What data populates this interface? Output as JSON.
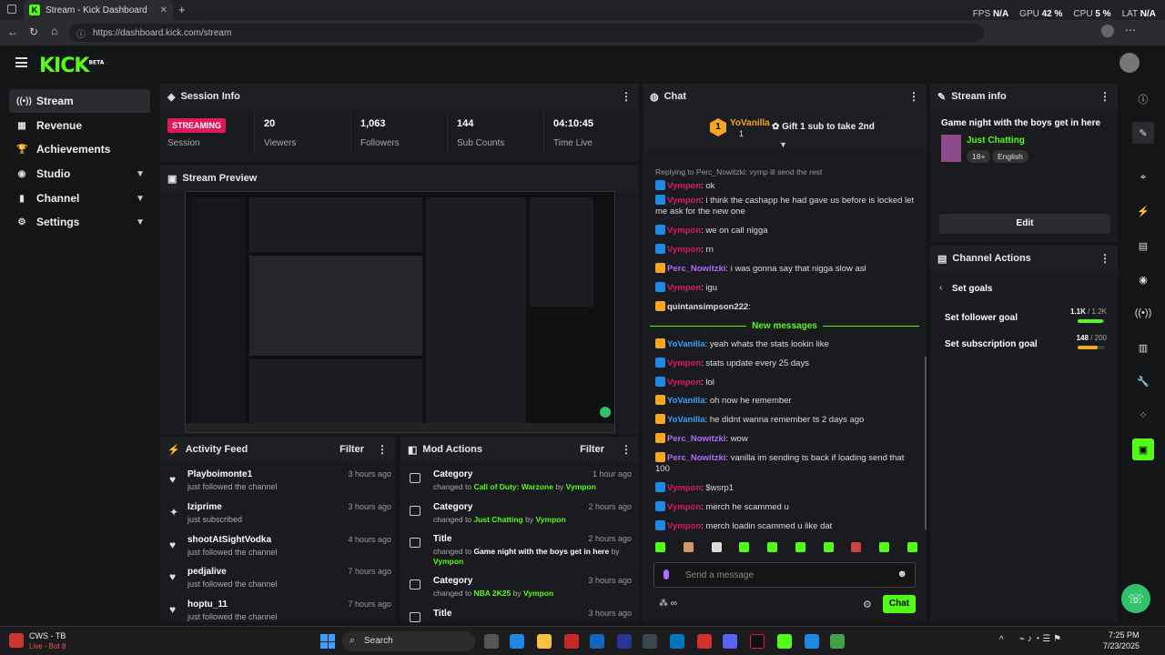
{
  "browser": {
    "tab_title": "Stream - Kick Dashboard",
    "url": "https://dashboard.kick.com/stream",
    "fps_label": "FPS",
    "fps": "N/A",
    "gpu_label": "GPU",
    "gpu": "42 %",
    "cpu_label": "CPU",
    "cpu": "5 %",
    "lat_label": "LAT",
    "lat": "N/A"
  },
  "app": {
    "logo": "KICK",
    "logo_tag": "BETA"
  },
  "sidebar": {
    "items": [
      {
        "label": "Stream",
        "icon": "broadcast-icon"
      },
      {
        "label": "Revenue",
        "icon": "revenue-icon"
      },
      {
        "label": "Achievements",
        "icon": "trophy-icon"
      },
      {
        "label": "Studio",
        "icon": "studio-icon"
      },
      {
        "label": "Channel",
        "icon": "channel-icon"
      },
      {
        "label": "Settings",
        "icon": "gear-icon"
      }
    ]
  },
  "session": {
    "title": "Session Info",
    "status": "STREAMING",
    "status_sub": "Session",
    "stats": [
      {
        "value": "20",
        "label": "Viewers"
      },
      {
        "value": "1,063",
        "label": "Followers"
      },
      {
        "value": "144",
        "label": "Sub Counts"
      },
      {
        "value": "04:10:45",
        "label": "Time Live"
      }
    ]
  },
  "preview": {
    "title": "Stream Preview"
  },
  "activity": {
    "title": "Activity Feed",
    "filter": "Filter",
    "items": [
      {
        "name": "Playboimonte1",
        "sub": "just followed the channel",
        "time": "3 hours ago",
        "icon": "heart-icon"
      },
      {
        "name": "Iziprime",
        "sub": "just subscribed",
        "time": "3 hours ago",
        "icon": "star-icon"
      },
      {
        "name": "shootAtSightVodka",
        "sub": "just followed the channel",
        "time": "4 hours ago",
        "icon": "heart-icon"
      },
      {
        "name": "pedjalive",
        "sub": "just followed the channel",
        "time": "7 hours ago",
        "icon": "heart-icon"
      },
      {
        "name": "hoptu_11",
        "sub": "just followed the channel",
        "time": "7 hours ago",
        "icon": "heart-icon"
      }
    ]
  },
  "mod": {
    "title": "Mod Actions",
    "filter": "Filter",
    "items": [
      {
        "name": "Category",
        "pre": "changed to ",
        "val": "Call of Duty: Warzone",
        "by": " by ",
        "user": "Vympon",
        "time": "1 hour ago"
      },
      {
        "name": "Category",
        "pre": "changed to ",
        "val": "Just Chatting",
        "by": " by ",
        "user": "Vympon",
        "time": "2 hours ago"
      },
      {
        "name": "Title",
        "pre": "changed to ",
        "val": "Game night with the boys get in here",
        "by": " by ",
        "user": "Vympon",
        "time": "2 hours ago"
      },
      {
        "name": "Category",
        "pre": "changed to ",
        "val": "NBA 2K25",
        "by": " by ",
        "user": "Vympon",
        "time": "3 hours ago"
      },
      {
        "name": "Title",
        "pre": "",
        "val": "",
        "by": "",
        "user": "",
        "time": "3 hours ago"
      }
    ]
  },
  "chat": {
    "title": "Chat",
    "pinned_user": "YoVanilla",
    "pinned_count": "1",
    "gift_text": "Gift 1 sub to take 2nd",
    "reply_text": "Replying to Perc_Nowitzki: vymp ill send the rest",
    "new_messages": "New messages",
    "input_placeholder": "Send a message",
    "send": "Chat",
    "messages": [
      {
        "user": "Vympon",
        "text": ": ok",
        "color": "#e2185b"
      },
      {
        "user": "Vympon",
        "text": ": i think the cashapp he had gave us before is locked let me ask for the new one",
        "color": "#e2185b"
      },
      {
        "user": "Vympon",
        "text": ": we on call nigga",
        "color": "#e2185b"
      },
      {
        "user": "Vympon",
        "text": ": rn",
        "color": "#e2185b"
      },
      {
        "user": "Perc_Nowitzki",
        "text": ": i was gonna say that nigga slow asl",
        "color": "#b06bff"
      },
      {
        "user": "Vympon",
        "text": ": igu",
        "color": "#e2185b"
      },
      {
        "user": "quintansimpson222",
        "text": ": ",
        "color": "#ddd"
      },
      {
        "user": "YoVanilla",
        "text": ": yeah whats the stats lookin like",
        "color": "#3aa0ff"
      },
      {
        "user": "Vympon",
        "text": ": stats update every 25 days",
        "color": "#e2185b"
      },
      {
        "user": "Vympon",
        "text": ": lol",
        "color": "#e2185b"
      },
      {
        "user": "YoVanilla",
        "text": ": oh now he remember",
        "color": "#3aa0ff"
      },
      {
        "user": "YoVanilla",
        "text": ": he didnt wanna remember ts 2 days ago",
        "color": "#3aa0ff"
      },
      {
        "user": "Perc_Nowitzki",
        "text": ": wow",
        "color": "#b06bff"
      },
      {
        "user": "Perc_Nowitzki",
        "text": ": vanilla im sending ts back if loading send that 100",
        "color": "#b06bff"
      },
      {
        "user": "Vympon",
        "text": ": $wsrp1",
        "color": "#e2185b"
      },
      {
        "user": "Vympon",
        "text": ": merch he scammed u",
        "color": "#e2185b"
      },
      {
        "user": "Vympon",
        "text": ": merch loadin scammed u like dat",
        "color": "#e2185b"
      }
    ]
  },
  "streaminfo": {
    "title": "Stream info",
    "stream_title": "Game night with the boys get in here",
    "category": "Just Chatting",
    "tag1": "18+",
    "tag2": "English",
    "edit": "Edit"
  },
  "actions": {
    "title": "Channel Actions",
    "back": "Set goals",
    "goals": [
      {
        "label": "Set follower goal",
        "current": "1.1K",
        "target": "/ 1.2K",
        "pct": 0.92,
        "color": "#53fc18"
      },
      {
        "label": "Set subscription goal",
        "current": "148",
        "target": "/ 200",
        "pct": 0.74,
        "color": "#f5a623"
      }
    ]
  },
  "taskbar": {
    "widget_title": "CWS - TB",
    "widget_sub": "Live - Bot 8",
    "search": "Search",
    "time": "7:25 PM",
    "date": "7/23/2025"
  }
}
